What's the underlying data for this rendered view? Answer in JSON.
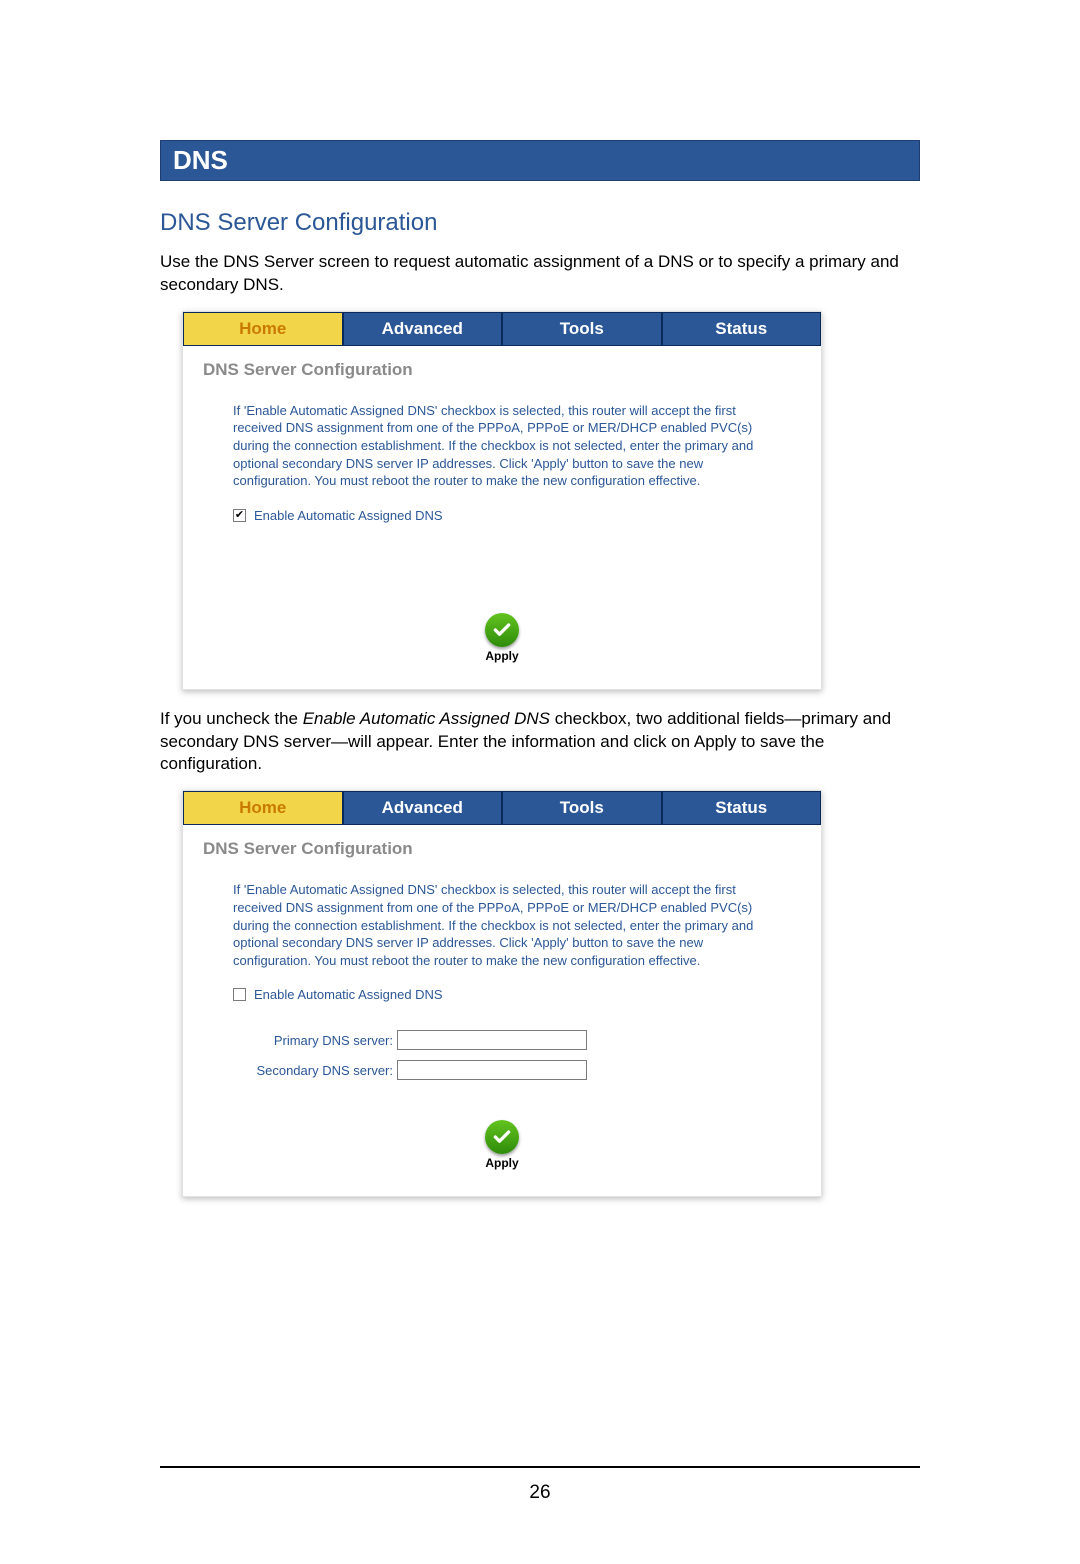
{
  "section_bar": "DNS",
  "sub_title": "DNS Server Configuration",
  "intro_text": "Use the DNS Server screen to request automatic assignment of a DNS or to specify a primary and secondary DNS.",
  "tabs": {
    "home": "Home",
    "advanced": "Advanced",
    "tools": "Tools",
    "status": "Status"
  },
  "panel_title": "DNS Server Configuration",
  "panel_desc": "If 'Enable Automatic Assigned DNS' checkbox is selected, this router will accept the first received DNS assignment from one of the PPPoA, PPPoE or MER/DHCP enabled PVC(s) during the connection establishment. If the checkbox is not selected, enter the primary and optional secondary DNS server IP addresses. Click 'Apply' button to save the new configuration. You must reboot the router to make the new configuration effective.",
  "checkbox_label": "Enable Automatic Assigned DNS",
  "apply_label": "Apply",
  "mid_text_pre": "If you uncheck the ",
  "mid_text_em": "Enable Automatic Assigned DNS",
  "mid_text_post": " checkbox, two additional fields—primary and secondary DNS server—will appear.  Enter the information and click on Apply to save the configuration.",
  "form": {
    "primary_label": "Primary DNS server:",
    "secondary_label": "Secondary DNS server:",
    "primary_value": "",
    "secondary_value": ""
  },
  "page_number": "26"
}
